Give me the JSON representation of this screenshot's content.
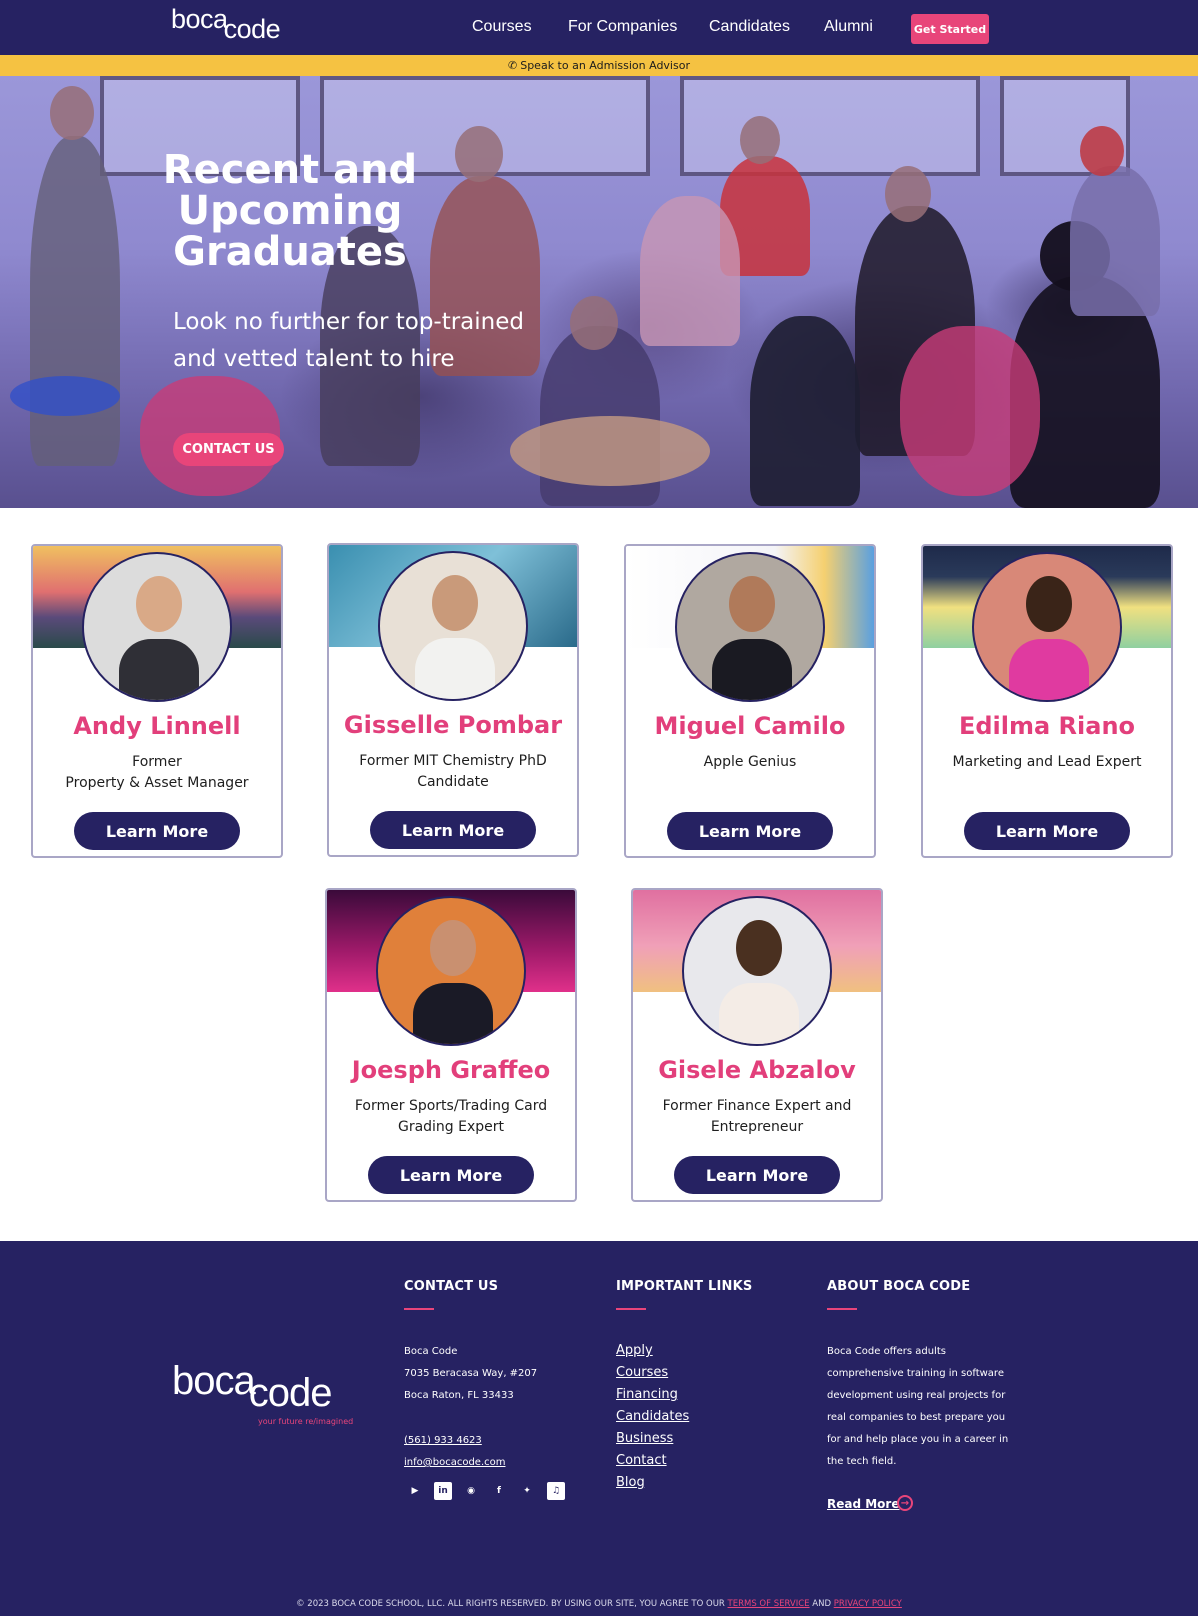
{
  "brand": {
    "logo_part1": "boca",
    "logo_part2": "code",
    "tagline": "your future re/imagined"
  },
  "nav": {
    "links": [
      "Courses",
      "For Companies",
      "Candidates",
      "Alumni"
    ],
    "cta": "Get Started"
  },
  "advisor_bar": {
    "text": "Speak to an Admission Advisor"
  },
  "hero": {
    "title": "Recent and Upcoming Graduates",
    "subtitle": "Look no further for top-trained and vetted talent to hire",
    "button": "CONTACT US"
  },
  "candidates": [
    {
      "name": "Andy Linnell",
      "title": "Former\nProperty & Asset Manager",
      "button": "Learn More"
    },
    {
      "name": "Gisselle Pombar",
      "title": "Former MIT Chemistry PhD\nCandidate",
      "button": "Learn More"
    },
    {
      "name": "Miguel Camilo",
      "title": "Apple Genius",
      "button": "Learn More"
    },
    {
      "name": "Edilma Riano",
      "title": "Marketing and Lead Expert",
      "button": "Learn More"
    },
    {
      "name": "Joesph Graffeo",
      "title": "Former Sports/Trading Card\nGrading Expert",
      "button": "Learn More"
    },
    {
      "name": "Gisele Abzalov",
      "title": "Former Finance Expert and\nEntrepreneur",
      "button": "Learn More"
    }
  ],
  "footer": {
    "contact": {
      "heading": "CONTACT US",
      "company": "Boca Code",
      "address1": "7035 Beracasa Way, #207",
      "address2": "Boca Raton, FL 33433",
      "phone": "(561) 933 4623",
      "email": "info@bocacode.com"
    },
    "links": {
      "heading": "IMPORTANT LINKS",
      "items": [
        "Apply",
        "Courses",
        "Financing",
        "Candidates",
        "Business",
        "Contact",
        "Blog"
      ]
    },
    "about": {
      "heading": "ABOUT BOCA CODE",
      "text_lines": [
        "Boca Code offers adults",
        "comprehensive training in software",
        "development using real projects for",
        "real companies to best prepare you",
        "for and help place you in a career in",
        "the tech field."
      ],
      "read_more": "Read More"
    },
    "social_icons": [
      "youtube-icon",
      "linkedin-icon",
      "instagram-icon",
      "facebook-icon",
      "twitter-icon",
      "tiktok-icon"
    ],
    "copyright": {
      "prefix": "© 2023 BOCA CODE SCHOOL, LLC. ALL RIGHTS RESERVED. BY USING OUR SITE, YOU AGREE TO OUR",
      "terms": "TERMS OF SERVICE",
      "and": "AND",
      "privacy": "PRIVACY POLICY"
    }
  },
  "colors": {
    "navy": "#262262",
    "pink": "#e8457a",
    "yellow": "#f5c242"
  }
}
